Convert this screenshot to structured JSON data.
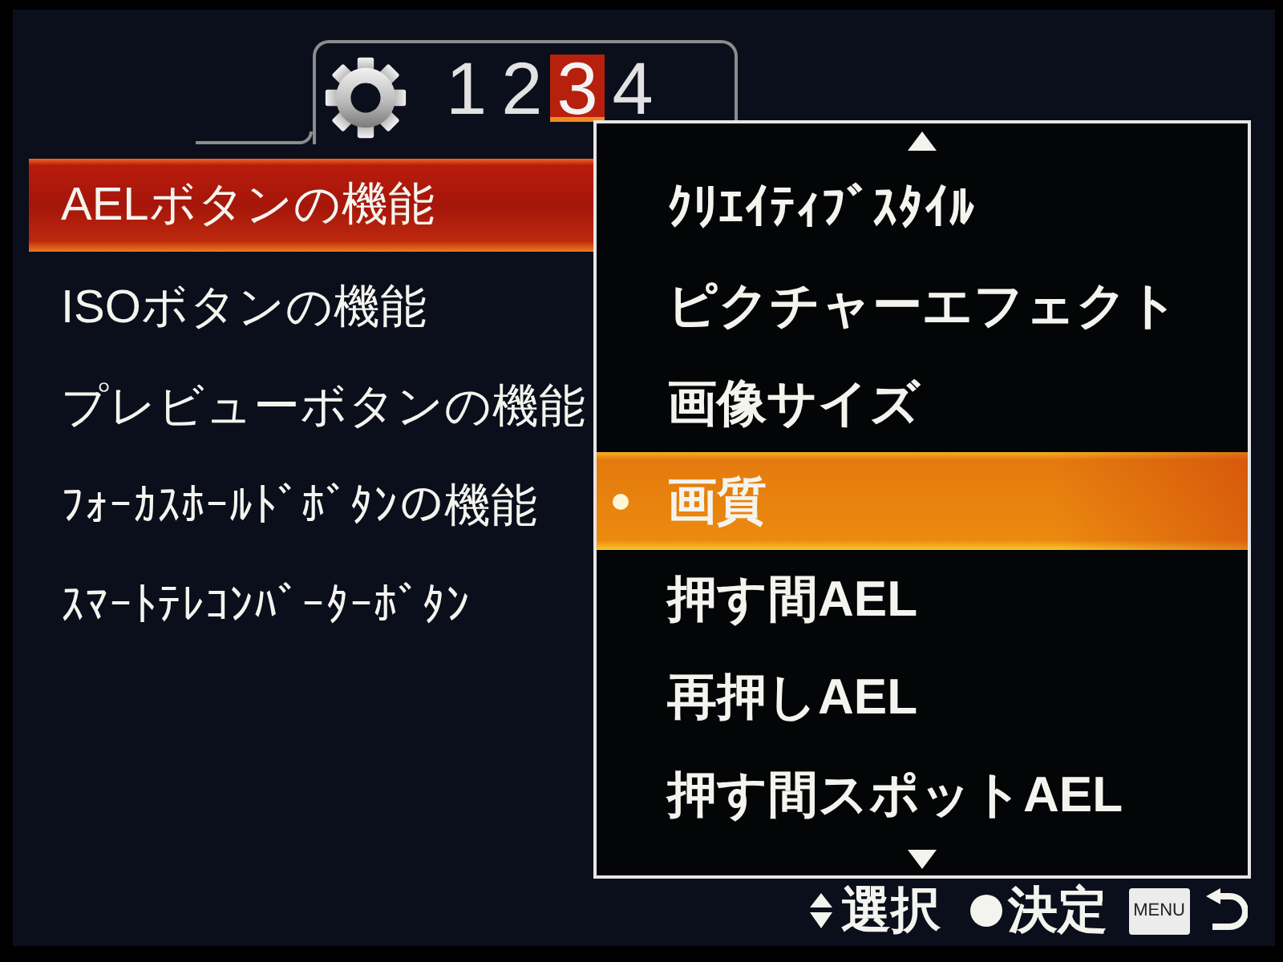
{
  "tabs": [
    {
      "label": "1",
      "selected": false
    },
    {
      "label": "2",
      "selected": false
    },
    {
      "label": "3",
      "selected": true
    },
    {
      "label": "4",
      "selected": false
    }
  ],
  "menu": [
    {
      "label": "AELボタンの機能",
      "selected": true
    },
    {
      "label": "ISOボタンの機能",
      "selected": false
    },
    {
      "label": "プレビューボタンの機能",
      "selected": false
    },
    {
      "label": "ﾌｫｰｶｽﾎｰﾙﾄﾞﾎﾞﾀﾝの機能",
      "selected": false
    },
    {
      "label": "ｽﾏｰﾄﾃﾚｺﾝﾊﾞｰﾀｰﾎﾞﾀﾝ",
      "selected": false
    }
  ],
  "dropdown": {
    "items": [
      {
        "label": "ｸﾘｴｲﾃｨﾌﾞｽﾀｲﾙ",
        "selected": false
      },
      {
        "label": "ピクチャーエフェクト",
        "selected": false
      },
      {
        "label": "画像サイズ",
        "selected": false
      },
      {
        "label": "画質",
        "selected": true
      },
      {
        "label": "押す間AEL",
        "selected": false
      },
      {
        "label": "再押しAEL",
        "selected": false
      },
      {
        "label": "押す間スポットAEL",
        "selected": false
      }
    ]
  },
  "hints": [
    {
      "kind": "select",
      "label": "選択"
    },
    {
      "kind": "confirm",
      "label": "決定"
    },
    {
      "kind": "back",
      "key": "MENU"
    }
  ]
}
